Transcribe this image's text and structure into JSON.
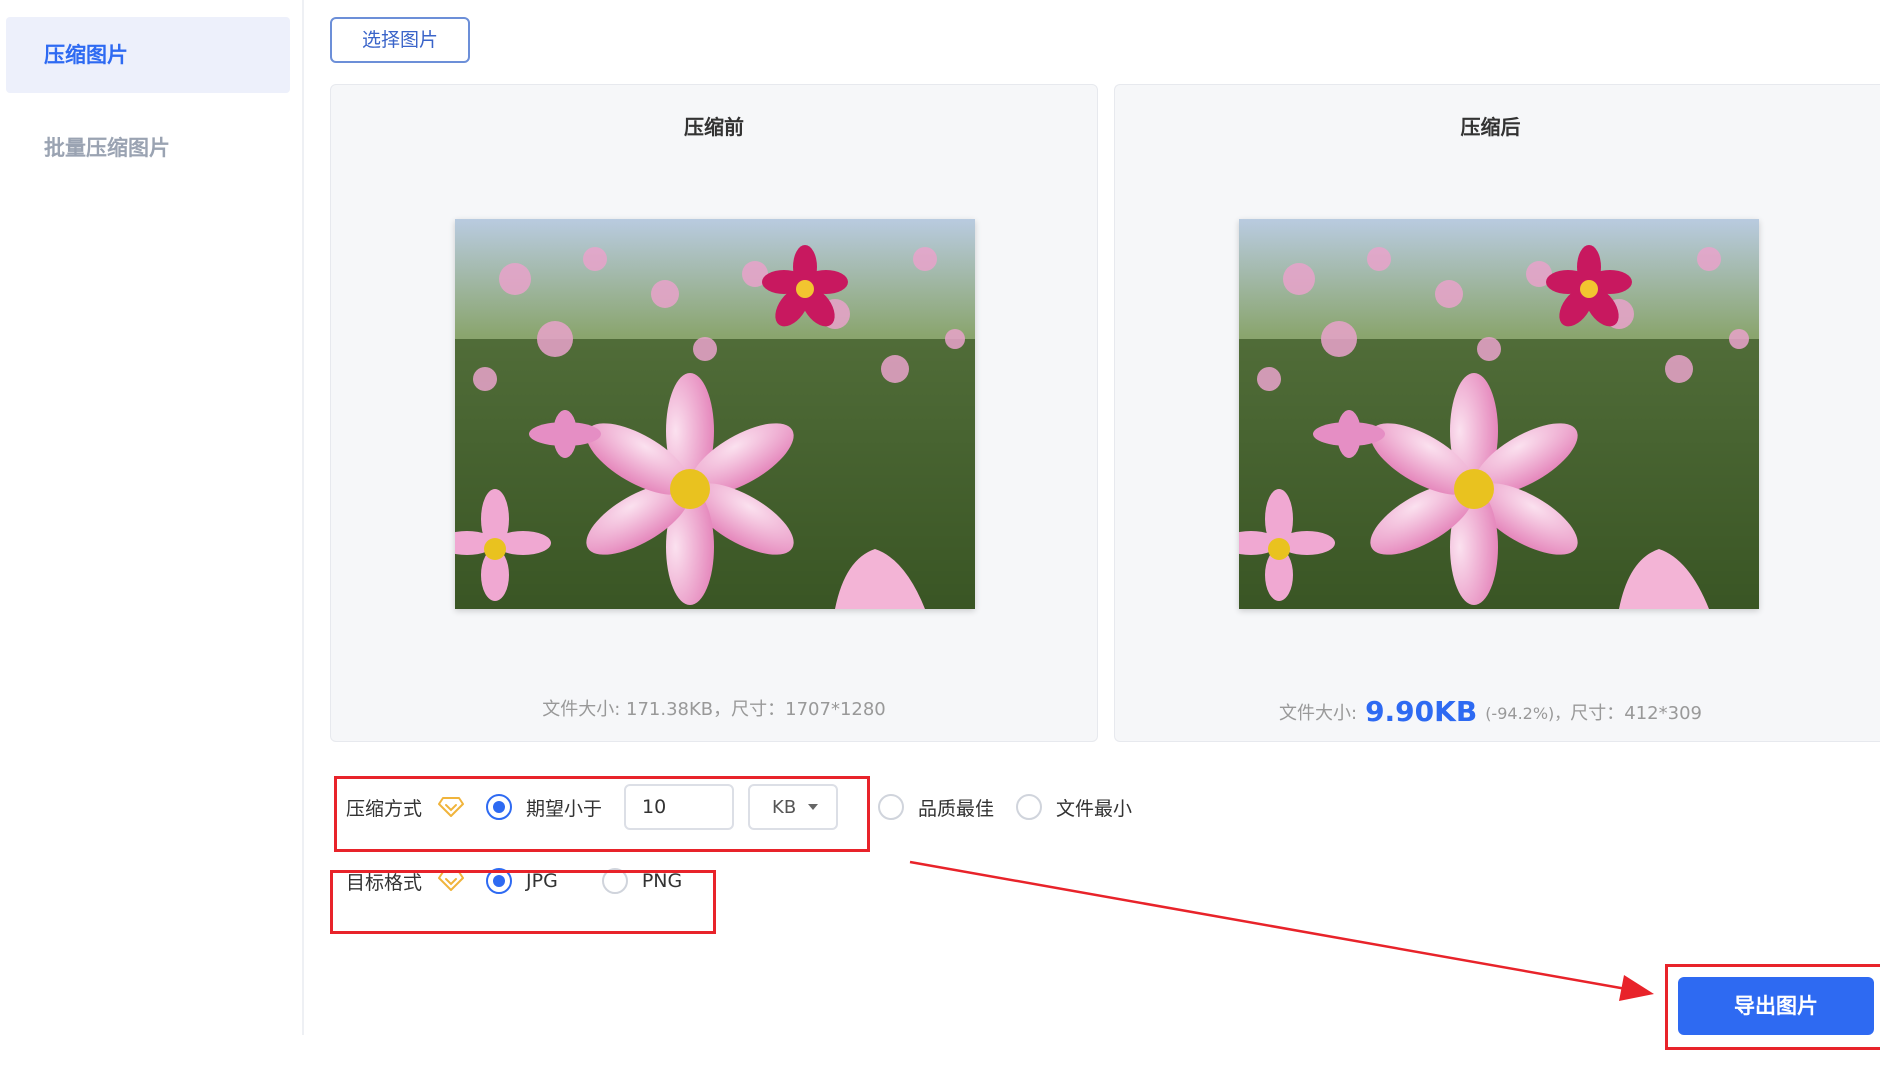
{
  "sidebar": {
    "items": [
      {
        "label": "压缩图片",
        "active": true
      },
      {
        "label": "批量压缩图片",
        "active": false
      }
    ]
  },
  "toolbar": {
    "select_label": "选择图片"
  },
  "before": {
    "title": "压缩前",
    "info": "文件大小: 171.38KB，尺寸：1707*1280"
  },
  "after": {
    "title": "压缩后",
    "size_prefix": "文件大小:",
    "size_value": "9.90KB",
    "pct": "(-94.2%)，",
    "dims": "尺寸：412*309"
  },
  "compress_mode": {
    "label": "压缩方式",
    "option_target": "期望小于",
    "target_value": "10",
    "unit": "KB",
    "option_quality": "品质最佳",
    "option_smallest": "文件最小",
    "selected": "target"
  },
  "target_format": {
    "label": "目标格式",
    "option_jpg": "JPG",
    "option_png": "PNG",
    "selected": "JPG"
  },
  "export": {
    "label": "导出图片"
  },
  "colors": {
    "accent": "#2e6af2",
    "annotation": "#e8232a",
    "vip": "#f0b43c"
  }
}
